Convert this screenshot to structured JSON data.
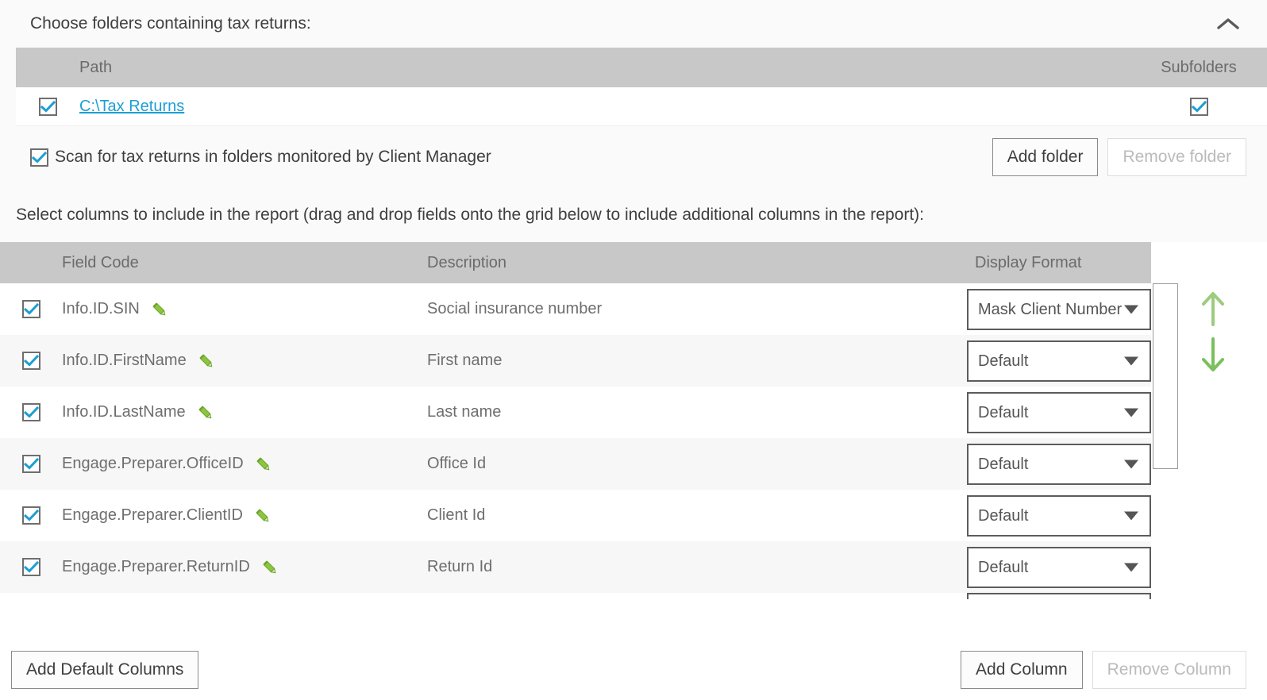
{
  "folders_section": {
    "title": "Choose folders containing tax returns:",
    "collapse_icon": "chevron-up-icon",
    "grid": {
      "columns": [
        "Path",
        "Subfolders"
      ],
      "rows": [
        {
          "checked": true,
          "path": "C:\\Tax Returns",
          "subfolders_checked": true
        }
      ]
    },
    "scan_checkbox": {
      "checked": true,
      "label": "Scan for tax returns in folders monitored by Client Manager"
    },
    "add_folder_label": "Add folder",
    "remove_folder_label": "Remove folder",
    "remove_folder_disabled": true
  },
  "columns_section": {
    "instruction": "Select columns to include in the report (drag and drop fields onto the grid below to include additional columns in the report):",
    "grid": {
      "columns": [
        "Field Code",
        "Description",
        "Display Format"
      ],
      "rows": [
        {
          "checked": true,
          "field_code": "Info.ID.SIN",
          "description": "Social insurance number",
          "display_format": "Mask Client Number"
        },
        {
          "checked": true,
          "field_code": "Info.ID.FirstName",
          "description": "First name",
          "display_format": "Default"
        },
        {
          "checked": true,
          "field_code": "Info.ID.LastName",
          "description": "Last name",
          "display_format": "Default"
        },
        {
          "checked": true,
          "field_code": "Engage.Preparer.OfficeID",
          "description": "Office Id",
          "display_format": "Default"
        },
        {
          "checked": true,
          "field_code": "Engage.Preparer.ClientID",
          "description": "Client Id",
          "display_format": "Default"
        },
        {
          "checked": true,
          "field_code": "Engage.Preparer.ReturnID",
          "description": "Return Id",
          "display_format": "Default"
        }
      ]
    },
    "move_up_icon": "arrow-up-icon",
    "move_down_icon": "arrow-down-icon",
    "add_default_columns_label": "Add Default Columns",
    "add_column_label": "Add Column",
    "remove_column_label": "Remove Column",
    "remove_column_disabled": true
  },
  "colors": {
    "check_blue": "#1c9fd4",
    "link_blue": "#1c9fd4",
    "pencil_green": "#8cc63f",
    "arrow_green": "#9ccc7f",
    "header_gray": "#c8c8c8",
    "panel_gray": "#fafafa"
  }
}
